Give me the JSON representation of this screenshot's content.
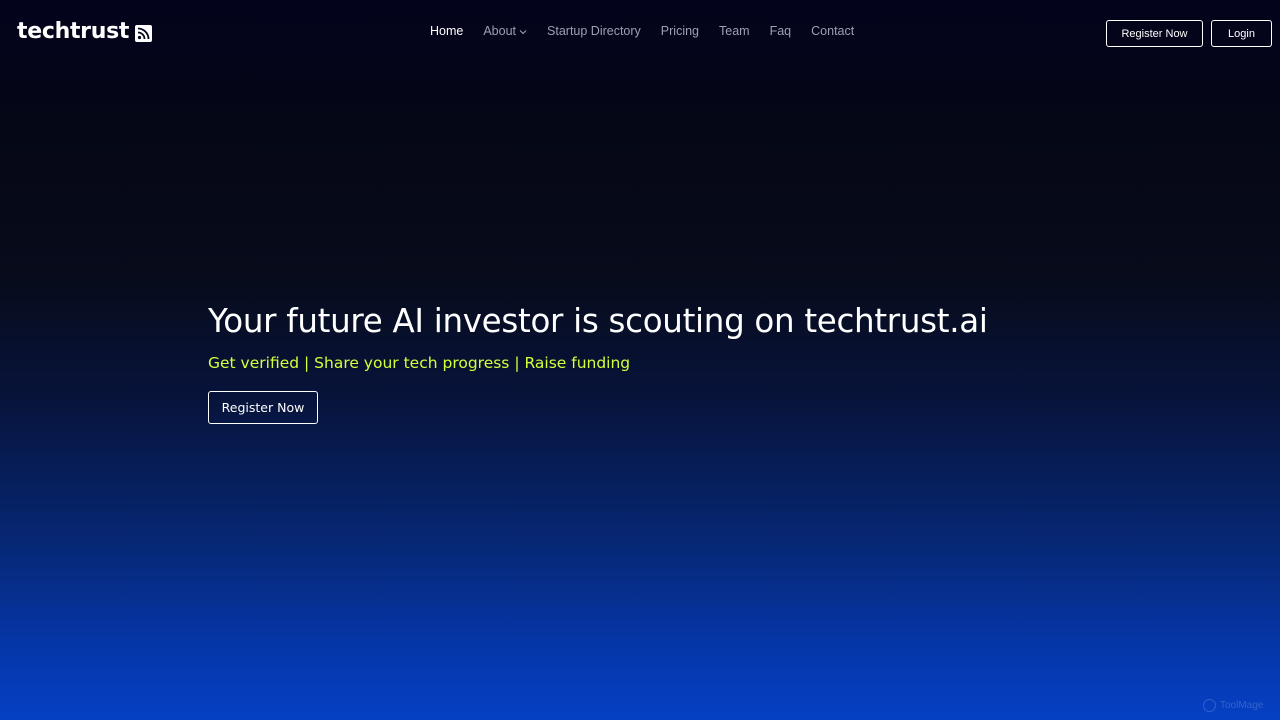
{
  "brand": {
    "name": "techtrust",
    "logo_icon": "rss-square-icon"
  },
  "nav": {
    "items": [
      {
        "label": "Home",
        "active": true
      },
      {
        "label": "About",
        "has_dropdown": true
      },
      {
        "label": "Startup Directory"
      },
      {
        "label": "Pricing"
      },
      {
        "label": "Team"
      },
      {
        "label": "Faq"
      },
      {
        "label": "Contact"
      }
    ],
    "register_label": "Register Now",
    "login_label": "Login"
  },
  "hero": {
    "title": "Your future AI investor is scouting on techtrust.ai",
    "subtitle": "Get verified | Share your tech progress | Raise funding",
    "cta_label": "Register Now"
  },
  "watermark": {
    "text": "ToolMage"
  },
  "colors": {
    "accent": "#d6ff3b",
    "background_top": "#03031c",
    "background_bottom": "#0540c4",
    "nav_inactive": "#9aa0b5"
  }
}
